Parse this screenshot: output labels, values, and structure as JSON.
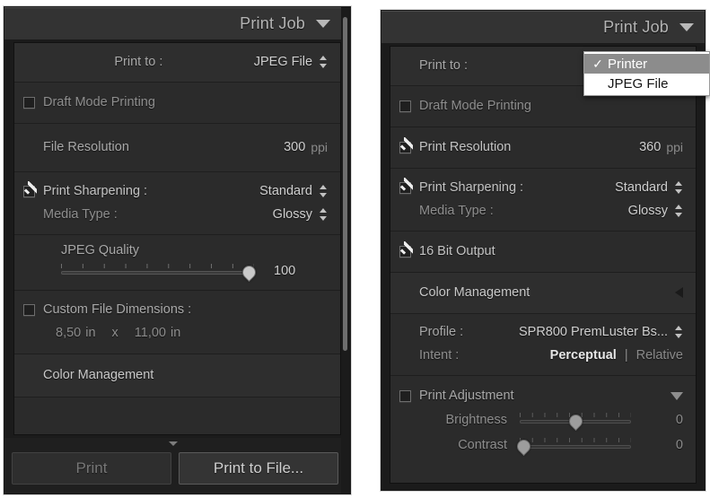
{
  "left_panel": {
    "header": {
      "title": "Print Job",
      "collapse_icon": "triangle-down-icon"
    },
    "print_to": {
      "label": "Print to :",
      "value": "JPEG File",
      "stepper_icon": "stepper-updown-icon"
    },
    "draft_mode": {
      "label": "Draft Mode Printing",
      "checked": false
    },
    "file_resolution": {
      "label": "File Resolution",
      "value": "300",
      "unit": "ppi"
    },
    "print_sharpening": {
      "label": "Print Sharpening :",
      "value": "Standard",
      "checked": true
    },
    "media_type": {
      "label": "Media Type :",
      "value": "Glossy"
    },
    "jpeg_quality": {
      "label": "JPEG Quality",
      "value": "100",
      "percent": 97
    },
    "custom_file_dimensions": {
      "label": "Custom File Dimensions :",
      "checked": false,
      "width": "8,50",
      "width_unit": "in",
      "separator": "x",
      "height": "11,00",
      "height_unit": "in"
    },
    "color_management": {
      "label": "Color Management"
    },
    "buttons": {
      "print": "Print",
      "print_to_file": "Print to File..."
    }
  },
  "right_panel": {
    "header": {
      "title": "Print Job",
      "collapse_icon": "triangle-down-icon"
    },
    "print_to": {
      "label": "Print to :"
    },
    "print_to_menu": {
      "items": [
        {
          "label": "Printer",
          "selected": true,
          "check": "✓"
        },
        {
          "label": "JPEG File",
          "selected": false,
          "check": ""
        }
      ]
    },
    "draft_mode": {
      "label": "Draft Mode Printing",
      "checked": false
    },
    "print_resolution": {
      "label": "Print Resolution",
      "value": "360",
      "unit": "ppi",
      "checked": true
    },
    "print_sharpening": {
      "label": "Print Sharpening :",
      "value": "Standard",
      "checked": true
    },
    "media_type": {
      "label": "Media Type :",
      "value": "Glossy"
    },
    "bit_output": {
      "label": "16 Bit Output",
      "checked": true
    },
    "color_management": {
      "label": "Color Management",
      "collapse_icon": "triangle-left-icon"
    },
    "profile": {
      "label": "Profile :",
      "value": "SPR800 PremLuster Bs..."
    },
    "intent": {
      "label": "Intent :",
      "active": "Perceptual",
      "separator": "|",
      "inactive": "Relative"
    },
    "print_adjustment": {
      "label": "Print Adjustment",
      "checked": false,
      "collapse_icon": "triangle-down-icon"
    },
    "brightness": {
      "label": "Brightness",
      "value": "0",
      "percent": 50
    },
    "contrast": {
      "label": "Contrast",
      "value": "0",
      "percent": 3
    }
  },
  "colors": {
    "panel_bg": "#2b2b2b",
    "header_bg": "#333333",
    "group_bg": "#2e2e2e",
    "shell_bg": "#1b1b1b",
    "text": "#a8a8a8",
    "value_text": "#cfcfcf",
    "menu_highlight": "#8c8c8c"
  }
}
